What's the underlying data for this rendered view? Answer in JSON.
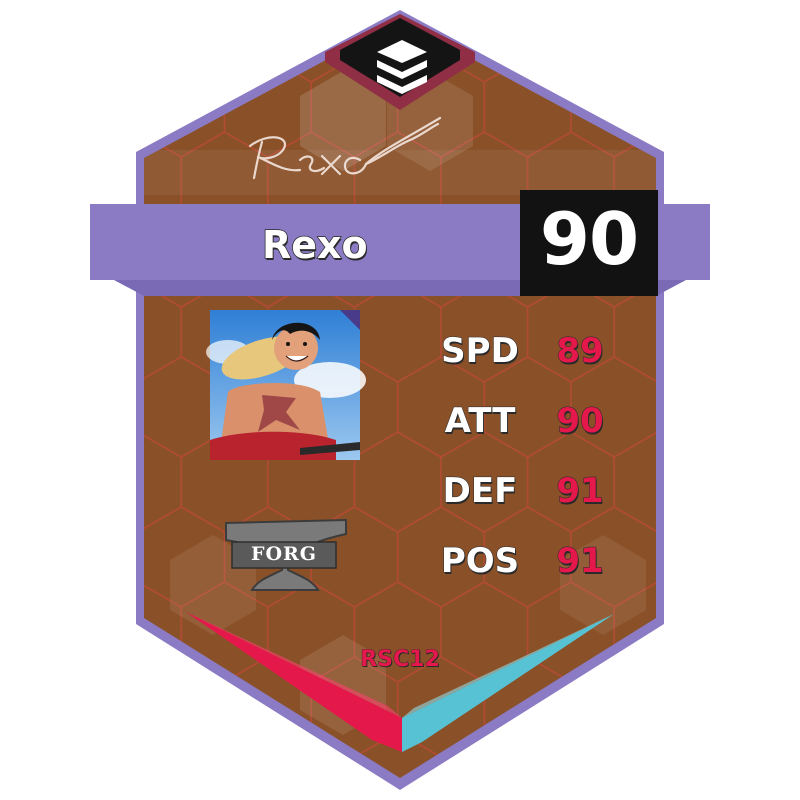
{
  "player": {
    "name": "Rexo",
    "signature": "Rexo",
    "overall": "90"
  },
  "stats": [
    {
      "label": "SPD",
      "value": "89"
    },
    {
      "label": "ATT",
      "value": "90"
    },
    {
      "label": "DEF",
      "value": "91"
    },
    {
      "label": "POS",
      "value": "91"
    }
  ],
  "club": {
    "logo_text": "FORG",
    "logo_icon": "anvil-icon"
  },
  "card_code": "RSC12",
  "icons": {
    "top_emblem": "stacked-layers-icon",
    "portrait": "character-portrait"
  },
  "colors": {
    "frame": "#8b7bc4",
    "card_background": "#8a5128",
    "hex_grid": "#c8463a",
    "rating_box": "#121212",
    "stat_value": "#e4184a",
    "chevron_left": "#e4184a",
    "chevron_right": "#57c2d4"
  }
}
